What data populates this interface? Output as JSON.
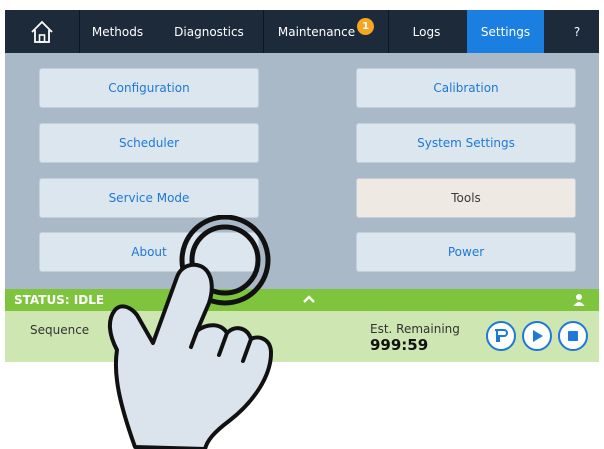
{
  "nav": {
    "home_icon": "home-icon",
    "tabs": [
      {
        "label": "Methods"
      },
      {
        "label": "Diagnostics"
      },
      {
        "label": "Maintenance",
        "badge": "1"
      },
      {
        "label": "Logs"
      },
      {
        "label": "Settings",
        "active": true
      },
      {
        "label": "?"
      }
    ]
  },
  "settings_buttons": {
    "configuration": "Configuration",
    "calibration": "Calibration",
    "scheduler": "Scheduler",
    "system_settings": "System Settings",
    "service_mode": "Service Mode",
    "tools": "Tools",
    "about": "About",
    "power": "Power"
  },
  "status": {
    "text": "STATUS: IDLE",
    "sequence_label": "Sequence",
    "est_remaining_label": "Est. Remaining",
    "est_remaining_value": "999:59"
  },
  "colors": {
    "accent": "#1a7fe0",
    "nav_bg": "#1c2a3a",
    "status_green": "#7ec43d",
    "panel_bg": "#a9b9c8",
    "badge": "#f5a623"
  },
  "icons": [
    "home-icon",
    "chevron-up-icon",
    "user-icon",
    "pump-icon",
    "play-icon",
    "stop-icon",
    "tap-gesture-hand-icon"
  ]
}
